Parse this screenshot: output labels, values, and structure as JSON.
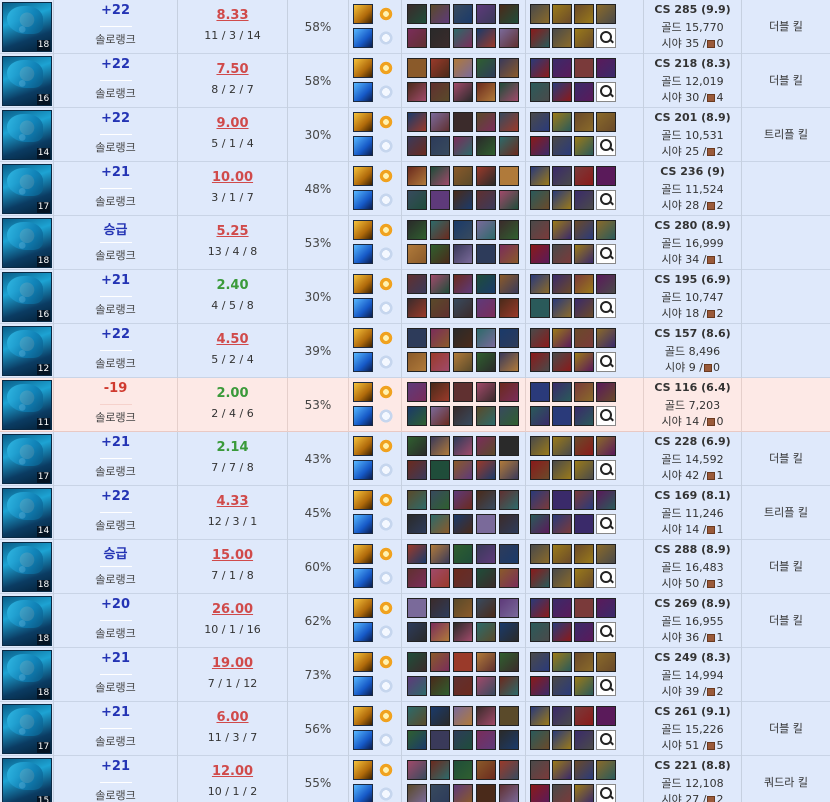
{
  "labels": {
    "queue": "솔로랭크",
    "cs_prefix": "CS",
    "gold_prefix": "골드",
    "vision_prefix": "시야"
  },
  "colors": {
    "win_row": "#dfe9fb",
    "loss_row": "#fde9e6",
    "lp_gain": "#2434b4",
    "lp_loss": "#d03a2f",
    "kda_red": "#d04a4a",
    "kda_green": "#3a9a3a"
  },
  "icons": {
    "champion": "champion-portrait-icon",
    "spell_1": "flash-spell-icon",
    "spell_2": "teleport-spell-icon",
    "rune_primary": "primary-rune-icon",
    "rune_secondary": "secondary-rune-icon",
    "ward": "control-ward-icon",
    "item_search": "magnifier-icon"
  },
  "matches": [
    {
      "level": "18",
      "lp": "+22",
      "result": "win",
      "kda_ratio": "8.33",
      "kda": "11 / 3 / 14",
      "kp": "58%",
      "cs": "CS 285 (9.9)",
      "gold": "골드 15,770",
      "vision": "시야 35 /",
      "wards": "0",
      "multikill": "더블 킬"
    },
    {
      "level": "16",
      "lp": "+22",
      "result": "win",
      "kda_ratio": "7.50",
      "kda": "8 / 2 / 7",
      "kp": "58%",
      "cs": "CS 218 (8.3)",
      "gold": "골드 12,019",
      "vision": "시야 30 /",
      "wards": "4",
      "multikill": "더블 킬"
    },
    {
      "level": "14",
      "lp": "+22",
      "result": "win",
      "kda_ratio": "9.00",
      "kda": "5 / 1 / 4",
      "kp": "30%",
      "cs": "CS 201 (8.9)",
      "gold": "골드 10,531",
      "vision": "시야 25 /",
      "wards": "2",
      "multikill": "트리플 킬"
    },
    {
      "level": "17",
      "lp": "+21",
      "result": "win",
      "kda_ratio": "10.00",
      "kda": "3 / 1 / 7",
      "kp": "48%",
      "cs": "CS 236 (9)",
      "gold": "골드 11,524",
      "vision": "시야 28 /",
      "wards": "2",
      "multikill": ""
    },
    {
      "level": "18",
      "lp": "승급",
      "result": "win",
      "kda_ratio": "5.25",
      "kda": "13 / 4 / 8",
      "kp": "53%",
      "cs": "CS 280 (8.9)",
      "gold": "골드 16,999",
      "vision": "시야 34 /",
      "wards": "1",
      "multikill": ""
    },
    {
      "level": "16",
      "lp": "+21",
      "result": "win",
      "kda_ratio": "2.40",
      "kda": "4 / 5 / 8",
      "kp": "30%",
      "cs": "CS 195 (6.9)",
      "gold": "골드 10,747",
      "vision": "시야 18 /",
      "wards": "2",
      "multikill": ""
    },
    {
      "level": "12",
      "lp": "+22",
      "result": "win",
      "kda_ratio": "4.50",
      "kda": "5 / 2 / 4",
      "kp": "39%",
      "cs": "CS 157 (8.6)",
      "gold": "골드 8,496",
      "vision": "시야 9 /",
      "wards": "0",
      "multikill": ""
    },
    {
      "level": "11",
      "lp": "-19",
      "result": "loss",
      "kda_ratio": "2.00",
      "kda": "2 / 4 / 6",
      "kp": "53%",
      "cs": "CS 116 (6.4)",
      "gold": "골드 7,203",
      "vision": "시야 14 /",
      "wards": "0",
      "multikill": ""
    },
    {
      "level": "17",
      "lp": "+21",
      "result": "win",
      "kda_ratio": "2.14",
      "kda": "7 / 7 / 8",
      "kp": "43%",
      "cs": "CS 228 (6.9)",
      "gold": "골드 14,592",
      "vision": "시야 42 /",
      "wards": "1",
      "multikill": "더블 킬"
    },
    {
      "level": "14",
      "lp": "+22",
      "result": "win",
      "kda_ratio": "4.33",
      "kda": "12 / 3 / 1",
      "kp": "45%",
      "cs": "CS 169 (8.1)",
      "gold": "골드 11,246",
      "vision": "시야 14 /",
      "wards": "1",
      "multikill": "트리플 킬"
    },
    {
      "level": "18",
      "lp": "승급",
      "result": "win",
      "kda_ratio": "15.00",
      "kda": "7 / 1 / 8",
      "kp": "60%",
      "cs": "CS 288 (8.9)",
      "gold": "골드 16,483",
      "vision": "시야 50 /",
      "wards": "3",
      "multikill": "더블 킬"
    },
    {
      "level": "18",
      "lp": "+20",
      "result": "win",
      "kda_ratio": "26.00",
      "kda": "10 / 1 / 16",
      "kp": "62%",
      "cs": "CS 269 (8.9)",
      "gold": "골드 16,955",
      "vision": "시야 36 /",
      "wards": "1",
      "multikill": "더블 킬"
    },
    {
      "level": "18",
      "lp": "+21",
      "result": "win",
      "kda_ratio": "19.00",
      "kda": "7 / 1 / 12",
      "kp": "73%",
      "cs": "CS 249 (8.3)",
      "gold": "골드 14,994",
      "vision": "시야 39 /",
      "wards": "2",
      "multikill": ""
    },
    {
      "level": "17",
      "lp": "+21",
      "result": "win",
      "kda_ratio": "6.00",
      "kda": "11 / 3 / 7",
      "kp": "56%",
      "cs": "CS 261 (9.1)",
      "gold": "골드 15,226",
      "vision": "시야 51 /",
      "wards": "5",
      "multikill": "더블 킬"
    },
    {
      "level": "15",
      "lp": "+21",
      "result": "win",
      "kda_ratio": "12.00",
      "kda": "10 / 1 / 2",
      "kp": "55%",
      "cs": "CS 221 (8.8)",
      "gold": "골드 12,108",
      "vision": "시야 27 /",
      "wards": "2",
      "multikill": "쿼드라 킬"
    }
  ]
}
